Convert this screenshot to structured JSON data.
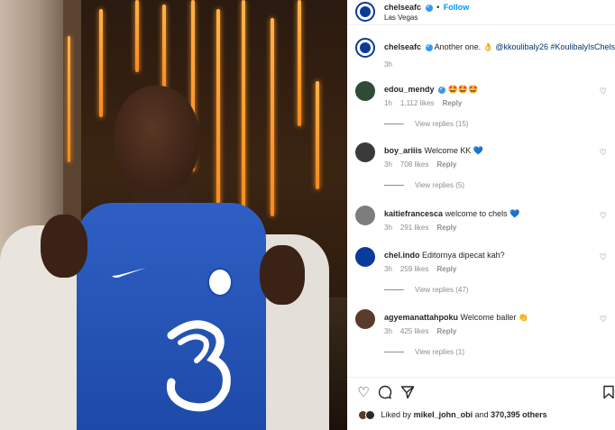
{
  "post": {
    "account": "chelseafc",
    "follow_label": "Follow",
    "separator": "•",
    "location": "Las Vegas",
    "caption": {
      "username": "chelseafc",
      "text_before": "Another one. 👌 ",
      "mention": "@kkoulibaly26",
      "hashtags": "#KoulibalyIsChelsea",
      "time": "3h"
    }
  },
  "comments": [
    {
      "username": "edou_mendy",
      "verified": true,
      "text": "🤩🤩🤩",
      "time": "1h",
      "likes": "1,112 likes",
      "reply": "Reply",
      "view_replies": "View replies (15)",
      "avatar_color": "#2f4a35"
    },
    {
      "username": "boy_ariiis",
      "verified": false,
      "text": "Welcome KK 💙",
      "time": "3h",
      "likes": "708 likes",
      "reply": "Reply",
      "view_replies": "View replies (5)",
      "avatar_color": "#3a3a3a"
    },
    {
      "username": "kaitiefrancesca",
      "verified": false,
      "text": "welcome to chels 💙",
      "time": "3h",
      "likes": "291 likes",
      "reply": "Reply",
      "view_replies": "",
      "avatar_color": "#7d7d7d"
    },
    {
      "username": "chel.indo",
      "verified": false,
      "text": "Editornya dipecat kah?",
      "time": "3h",
      "likes": "259 likes",
      "reply": "Reply",
      "view_replies": "View replies (47)",
      "avatar_color": "#0a3a9a"
    },
    {
      "username": "agyemanattahpoku",
      "verified": false,
      "text": "Welcome baller 👏",
      "time": "3h",
      "likes": "425 likes",
      "reply": "Reply",
      "view_replies": "View replies (1)",
      "avatar_color": "#5a3a2a"
    }
  ],
  "actions": {
    "like_icon": "heart-icon",
    "comment_icon": "comment-icon",
    "share_icon": "share-icon",
    "save_icon": "bookmark-icon",
    "liked_by_prefix": "Liked by",
    "liked_by_user": "mikel_john_obi",
    "liked_by_and": "and",
    "liked_by_count": "370,395 others"
  },
  "colors": {
    "accent": "#0095f6",
    "verified": "#3897f0",
    "chelsea_blue": "#1d4aa8",
    "meta_gray": "#8e8e8e"
  }
}
